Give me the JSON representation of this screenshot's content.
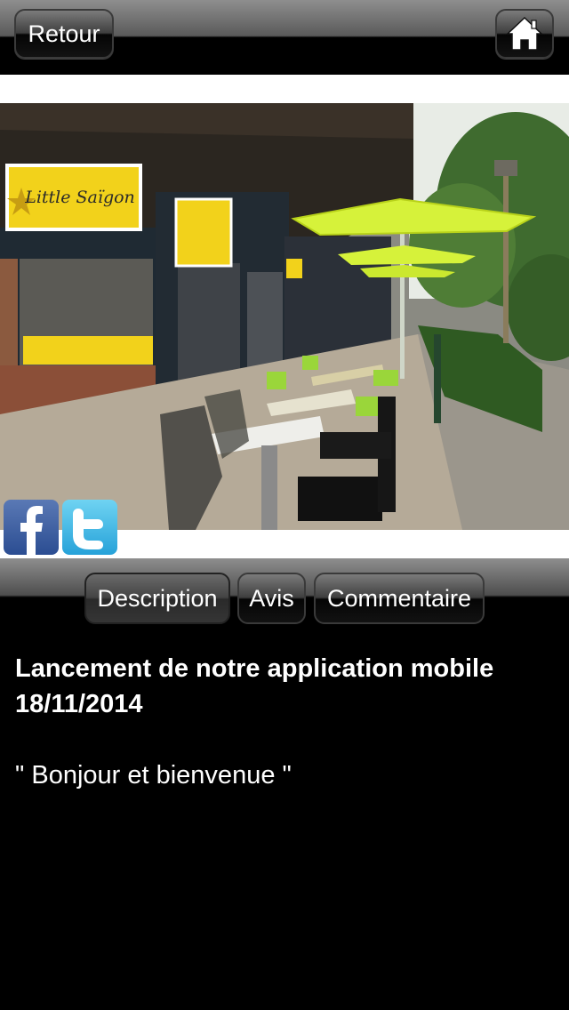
{
  "nav": {
    "back_label": "Retour",
    "home_icon": "home-icon"
  },
  "social": {
    "facebook_icon": "facebook-icon",
    "twitter_icon": "twitter-icon"
  },
  "tabs": [
    {
      "label": "Description",
      "active": true
    },
    {
      "label": "Avis",
      "active": false
    },
    {
      "label": "Commentaire",
      "active": false
    }
  ],
  "article": {
    "title": "Lancement de notre application mobile",
    "date": "18/11/2014",
    "body": "\" Bonjour et bienvenue \""
  },
  "photo": {
    "sign_text": "Little Saïgon",
    "accent_yellow": "#f2d21b",
    "umbrella_green": "#d6f23a"
  }
}
